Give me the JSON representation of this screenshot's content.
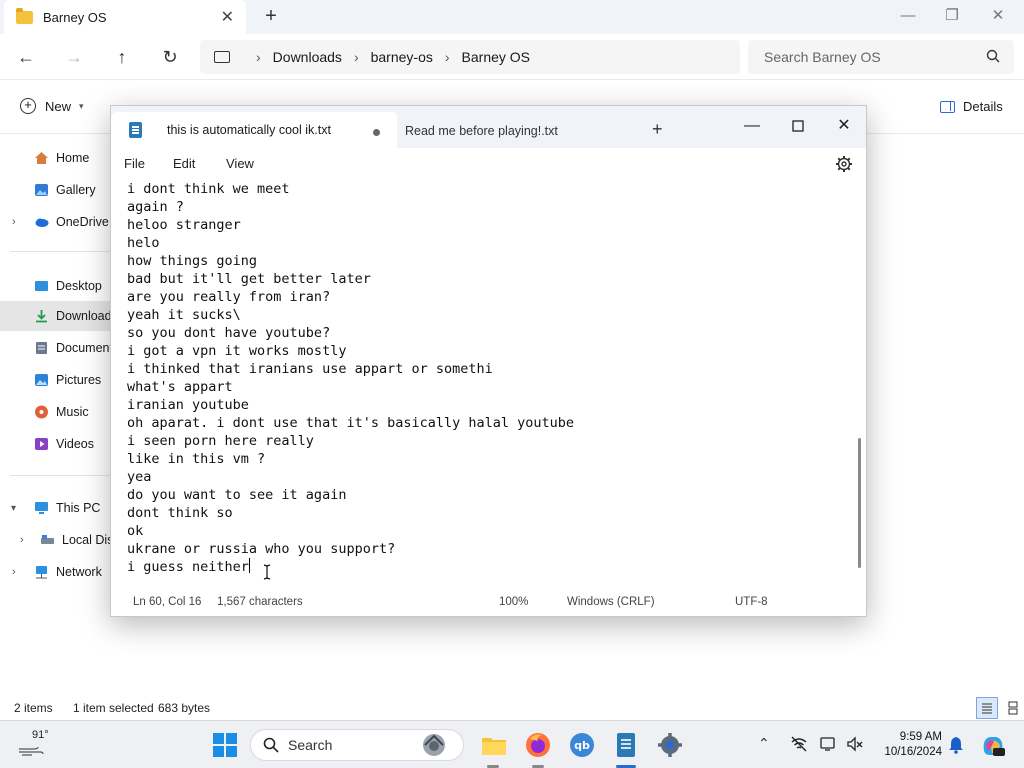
{
  "explorer": {
    "tab_title": "Barney OS",
    "breadcrumb": [
      "Downloads",
      "barney-os",
      "Barney OS"
    ],
    "search_placeholder": "Search Barney OS",
    "new_label": "New",
    "details_label": "Details",
    "sidebar": [
      {
        "label": "Home",
        "icon": "home-icon"
      },
      {
        "label": "Gallery",
        "icon": "gallery-icon"
      },
      {
        "label": "OneDrive",
        "icon": "onedrive-icon"
      },
      {
        "label": "Desktop",
        "icon": "desktop-icon"
      },
      {
        "label": "Downloads",
        "icon": "downloads-icon",
        "selected": true
      },
      {
        "label": "Documents",
        "icon": "documents-icon"
      },
      {
        "label": "Pictures",
        "icon": "pictures-icon"
      },
      {
        "label": "Music",
        "icon": "music-icon"
      },
      {
        "label": "Videos",
        "icon": "videos-icon"
      },
      {
        "label": "This PC",
        "icon": "this-pc-icon"
      },
      {
        "label": "Local Disk",
        "icon": "local-disk-icon"
      },
      {
        "label": "Network",
        "icon": "network-icon"
      }
    ],
    "status": {
      "items": "2 items",
      "selected": "1 item selected",
      "size": "683 bytes"
    }
  },
  "notepad": {
    "tabs": [
      {
        "label": "this is automatically cool ik.txt",
        "active": true,
        "unsaved": true
      },
      {
        "label": "Read me before playing!.txt",
        "active": false
      }
    ],
    "menu": [
      "File",
      "Edit",
      "View"
    ],
    "lines": [
      "i dont think we meet",
      "again ?",
      "heloo stranger",
      "helo",
      "how things going",
      "bad but it'll get better later",
      "are you really from iran?",
      "yeah it sucks\\",
      "so you dont have youtube?",
      "i got a vpn it works mostly",
      "i thinked that iranians use appart or somethi",
      "what's appart",
      "iranian youtube",
      "oh aparat. i dont use that it's basically halal youtube",
      "i seen porn here really",
      "like in this vm ?",
      "yea",
      "do you want to see it again",
      "dont think so",
      "ok",
      "ukrane or russia who you support?",
      "i guess neither"
    ],
    "status": {
      "position": "Ln 60, Col 16",
      "characters": "1,567 characters",
      "zoom": "100%",
      "line_ending": "Windows (CRLF)",
      "encoding": "UTF-8"
    }
  },
  "taskbar": {
    "weather": "91°",
    "search_label": "Search",
    "time": "9:59 AM",
    "date": "10/16/2024"
  },
  "colors": {
    "accent": "#2a6bd3",
    "folder": "#f5c33b",
    "notepad": "#2a7ab8"
  }
}
